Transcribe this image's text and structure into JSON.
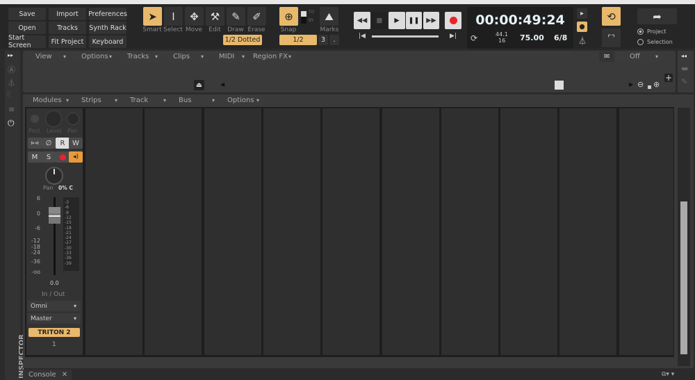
{
  "toolbar": {
    "buttons": [
      "Save",
      "Import",
      "Preferences",
      "Open",
      "Tracks",
      "Synth Rack",
      "Start Screen",
      "Fit Project",
      "Keyboard"
    ],
    "tools": [
      {
        "label": "Smart",
        "icon": "arrow-cursor-icon",
        "glyph": "➤"
      },
      {
        "label": "Select",
        "icon": "ibeam-icon",
        "glyph": "I"
      },
      {
        "label": "Move",
        "icon": "move-icon",
        "glyph": "✥"
      },
      {
        "label": "Edit",
        "icon": "wrench-icon",
        "glyph": "⚒"
      },
      {
        "label": "Draw",
        "icon": "pencil-icon",
        "glyph": "✎"
      },
      {
        "label": "Erase",
        "icon": "eraser-icon",
        "glyph": "✐"
      }
    ],
    "draw_duration": "1/2 Dotted",
    "snap_label": "Snap",
    "snap_value": "1/2",
    "snap_triplet": "3",
    "snap_dot": ".",
    "to_label": "TO",
    "by_label": "BY",
    "marks_label": "Marks"
  },
  "transport": {
    "time": "00:00:49:24",
    "sample_rate": "44.1",
    "bit_depth": "16",
    "tempo": "75.00",
    "meter": "6/8",
    "export_project": "Project",
    "export_selection": "Selection"
  },
  "track_view": {
    "menus": [
      "View",
      "Options",
      "Tracks",
      "Clips",
      "MIDI",
      "Region FX"
    ],
    "automation": "Off"
  },
  "console": {
    "menus": [
      "Modules",
      "Strips",
      "Track",
      "Bus",
      "Options"
    ],
    "tab": "Console"
  },
  "strip": {
    "post": "Post",
    "level": "Level",
    "pan": "Pan",
    "buttons": [
      "R",
      "W",
      "M",
      "S"
    ],
    "pan_label": "Pan",
    "pan_value": "0% C",
    "fader_scale": [
      "6",
      "0",
      "-6",
      "-12",
      "-18",
      "-24",
      "-36",
      "-oo"
    ],
    "meter_scale": [
      "-3",
      "-6",
      "-9",
      "-12",
      "-15",
      "-18",
      "-21",
      "-24",
      "-27",
      "-30",
      "-33",
      "-36",
      "-39"
    ],
    "volume": "0.0",
    "inout": "In / Out",
    "input": "Omni",
    "output": "Master",
    "name": "TRITON 2",
    "number": "1"
  },
  "inspector_label": "INSPECTOR",
  "colors": {
    "accent": "#e8b86b",
    "record": "#e8232a"
  }
}
